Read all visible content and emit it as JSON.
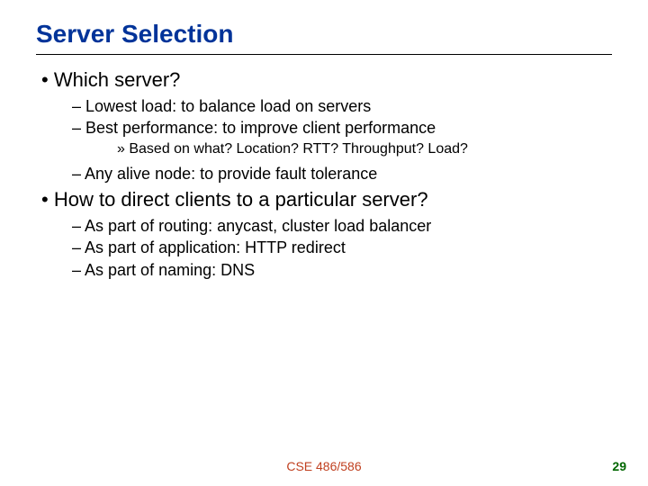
{
  "title": "Server Selection",
  "bullets": {
    "b1": "Which server?",
    "b1a": "Lowest load: to balance load on servers",
    "b1b": "Best performance: to improve client performance",
    "b1b1": "Based on what? Location? RTT? Throughput? Load?",
    "b1c": "Any alive node: to provide fault tolerance",
    "b2": "How to direct clients to a particular server?",
    "b2a": "As part of routing: anycast, cluster load balancer",
    "b2b": "As part of application: HTTP redirect",
    "b2c": "As part of naming: DNS"
  },
  "footer": {
    "course": "CSE 486/586",
    "page": "29"
  }
}
